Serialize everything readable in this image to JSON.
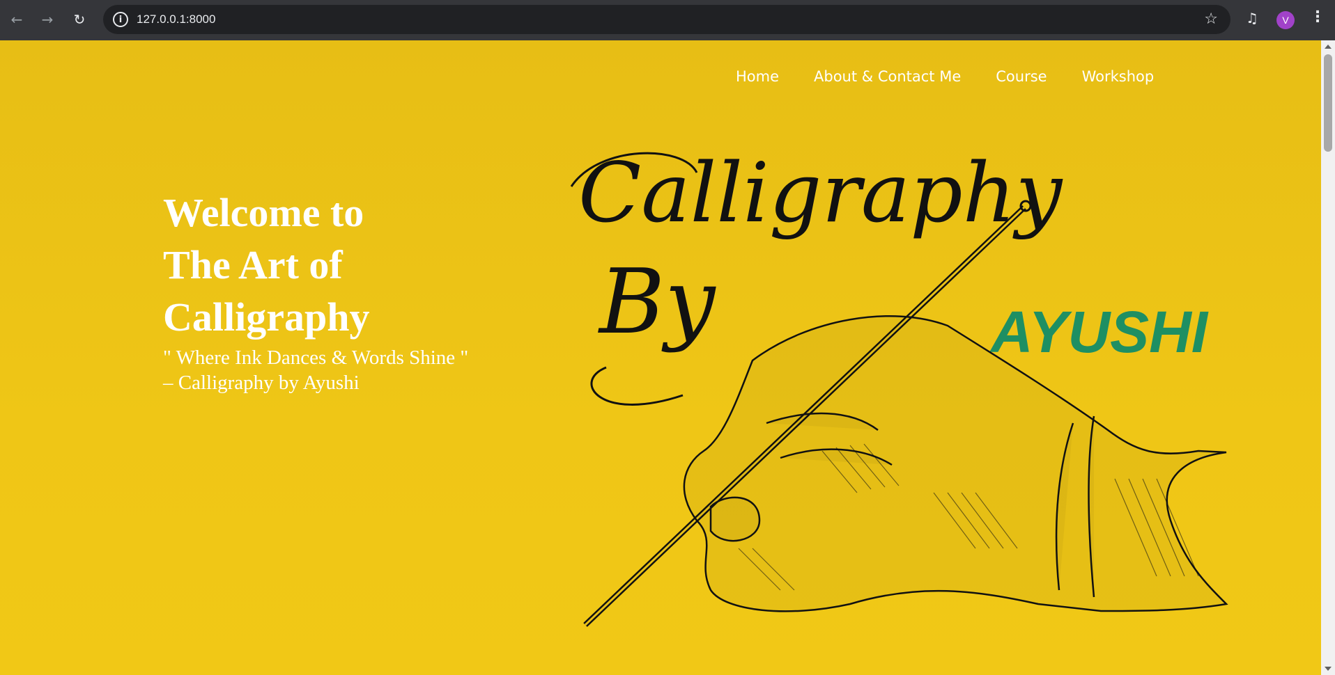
{
  "browser": {
    "url": "127.0.0.1:8000",
    "profile_initial": "V",
    "icons": {
      "back": "arrow-left-icon",
      "forward": "arrow-right-icon",
      "reload": "reload-icon",
      "site_info": "info-icon",
      "bookmark": "star-icon",
      "media": "media-queue-icon",
      "menu": "kebab-menu-icon"
    }
  },
  "nav": {
    "items": [
      {
        "label": "Home"
      },
      {
        "label": "About & Contact Me"
      },
      {
        "label": "Course"
      },
      {
        "label": "Workshop"
      }
    ]
  },
  "hero": {
    "title_line1": "Welcome to",
    "title_line2": "The Art of",
    "title_line3": "Calligraphy",
    "tagline_line1": "\" Where Ink Dances & Words Shine \"",
    "tagline_line2": "– Calligraphy by Ayushi"
  },
  "artwork": {
    "script_word1": "Calligraphy",
    "script_word2": "By",
    "brand_name": "AYUSHI"
  },
  "colors": {
    "page_background": "#efc616",
    "brand_green": "#1e8f63",
    "text_white": "#ffffff",
    "ink": "#111111"
  }
}
